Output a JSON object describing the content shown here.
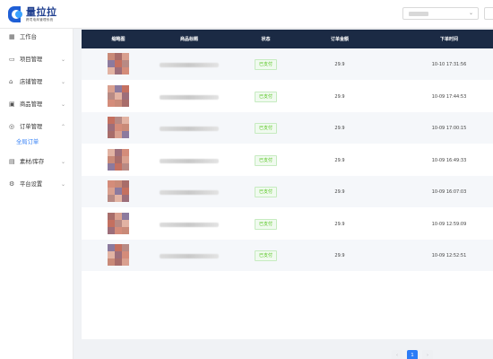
{
  "brand": {
    "name": "量拉拉",
    "tagline": "跨境电商管理系统"
  },
  "header": {
    "shop_select_chevron": "chevron-down-icon"
  },
  "sidebar": {
    "items": [
      {
        "label": "工作台",
        "icon": "dashboard-icon",
        "expandable": false
      },
      {
        "label": "项目管理",
        "icon": "project-icon",
        "expandable": true
      },
      {
        "label": "店铺管理",
        "icon": "store-icon",
        "expandable": true
      },
      {
        "label": "商品管理",
        "icon": "product-icon",
        "expandable": true
      },
      {
        "label": "订单管理",
        "icon": "order-icon",
        "expandable": true,
        "expanded": true
      },
      {
        "label": "素材/库存",
        "icon": "material-icon",
        "expandable": true
      },
      {
        "label": "平台设置",
        "icon": "settings-icon",
        "expandable": true
      }
    ],
    "sub_item": {
      "label": "全局订单",
      "active": true
    }
  },
  "table": {
    "columns": [
      "缩略图",
      "商品标题",
      "状态",
      "订单金额",
      "下单时间"
    ],
    "rows": [
      {
        "status": "已支付",
        "amount": "29.9",
        "time": "10-10 17:31:56"
      },
      {
        "status": "已支付",
        "amount": "29.9",
        "time": "10-09 17:44:53"
      },
      {
        "status": "已支付",
        "amount": "29.9",
        "time": "10-09 17:00:15"
      },
      {
        "status": "已支付",
        "amount": "29.9",
        "time": "10-09 16:49:33"
      },
      {
        "status": "已支付",
        "amount": "29.9",
        "time": "10-09 16:07:03"
      },
      {
        "status": "已支付",
        "amount": "29.9",
        "time": "10-09 12:59:09"
      },
      {
        "status": "已支付",
        "amount": "29.9",
        "time": "10-09 12:52:51"
      }
    ]
  },
  "pagination": {
    "prev": "‹",
    "current": "1",
    "next": "›"
  },
  "colors": {
    "accent": "#2d7cf6",
    "header_bg": "#1b2a44",
    "status_green": "#52c41a"
  }
}
